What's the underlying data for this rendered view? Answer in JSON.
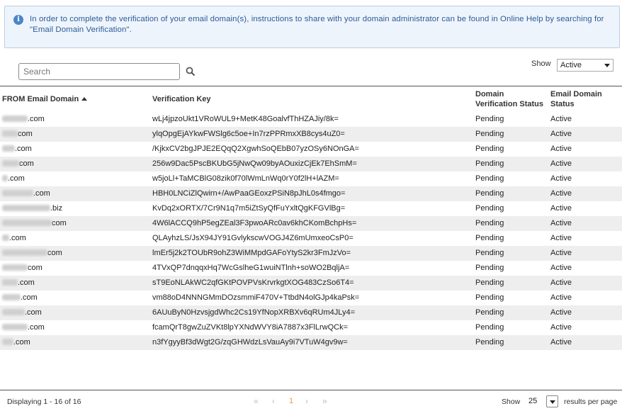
{
  "banner": {
    "icon": "info-icon",
    "text": "In order to complete the verification of your email domain(s), instructions to share with your domain administrator can be found in Online Help by searching for \"Email Domain Verification\"."
  },
  "search": {
    "placeholder": "Search",
    "value": "",
    "icon": "search-icon"
  },
  "filter": {
    "label": "Show",
    "selected": "Active"
  },
  "table": {
    "headers": {
      "domain": "FROM Email Domain",
      "key": "Verification Key",
      "dvs_line1": "Domain",
      "dvs_line2": "Verification Status",
      "eds_line1": "Email Domain",
      "eds_line2": "Status"
    },
    "sort": {
      "column": "FROM Email Domain",
      "direction": "ascending"
    },
    "rows": [
      {
        "domain": ".com",
        "key": "wLj4jpzoUkt1VRoWUL9+MetK48GoalvfThHZAJiy/8k=",
        "dvs": "Pending",
        "eds": "Active"
      },
      {
        "domain": "com",
        "key": "ylqOpgEjAYkwFWSlg6c5oe+In7rzPPRmxXB8cys4uZ0=",
        "dvs": "Pending",
        "eds": "Active"
      },
      {
        "domain": ".com",
        "key": "/KjkxCV2bgJPJE2EQqQ2XgwhSoQEbB07yzOSy6NOnGA=",
        "dvs": "Pending",
        "eds": "Active"
      },
      {
        "domain": "com",
        "key": "256w9Dac5PscBKUbG5jNwQw09byAOuxizCjEk7EhSmM=",
        "dvs": "Pending",
        "eds": "Active"
      },
      {
        "domain": ".com",
        "key": "w5joLl+TaMCBlG08zik0f70lWmLnWq0rY0f2lH+lAZM=",
        "dvs": "Pending",
        "eds": "Active"
      },
      {
        "domain": ".com",
        "key": "HBH0LNCiZlQwirn+/AwPaaGEoxzPSiN8pJhL0s4fmgo=",
        "dvs": "Pending",
        "eds": "Active"
      },
      {
        "domain": ".biz",
        "key": "KvDq2xORTX/7Cr9N1q7m5iZtSyQfFuYxltQgKFGVlBg=",
        "dvs": "Pending",
        "eds": "Active"
      },
      {
        "domain": "com",
        "key": "4W6lACCQ9hP5egZEal3F3pwoARc0av6khCKomBchpHs=",
        "dvs": "Pending",
        "eds": "Active"
      },
      {
        "domain": ".com",
        "key": "QLAyhzLS/JsX94JY91GvlykscwVOGJ4Z6mUmxeoCsP0=",
        "dvs": "Pending",
        "eds": "Active"
      },
      {
        "domain": "com",
        "key": "lmEr5j2k2TOUbR9ohZ3WiMMpdGAFoYtyS2kr3FmJzVo=",
        "dvs": "Pending",
        "eds": "Active"
      },
      {
        "domain": "com",
        "key": "4TVxQP7dnqqxHq7WcGslheG1wuiNTlnh+soWO2BqljA=",
        "dvs": "Pending",
        "eds": "Active"
      },
      {
        "domain": ".com",
        "key": "sT9EoNLAkWC2qfGKtPOVPVsKrvrkgtXOG483CzSo6T4=",
        "dvs": "Pending",
        "eds": "Active"
      },
      {
        "domain": ".com",
        "key": "vm88oD4NNNGMmDOzsmmiF470V+TtbdN4olGJp4kaPsk=",
        "dvs": "Pending",
        "eds": "Active"
      },
      {
        "domain": ".com",
        "key": "6AUuByN0HzvsjgdWhc2Cs19YfNopXRBXv6qRUm4JLy4=",
        "dvs": "Pending",
        "eds": "Active"
      },
      {
        "domain": ".com",
        "key": "fcamQrT8gwZuZVKt8lpYXNdWVY8iA7887x3FlLrwQCk=",
        "dvs": "Pending",
        "eds": "Active"
      },
      {
        "domain": ".com",
        "key": "n3fYgyyBf3dWgt2G/zqGHWdzLsVauAy9i7VTuW4gv9w=",
        "dvs": "Pending",
        "eds": "Active"
      }
    ]
  },
  "footer": {
    "displaying": "Displaying 1 - 16 of 16",
    "pager": {
      "first": "«",
      "prev": "‹",
      "current": "1",
      "next": "›",
      "last": "»"
    },
    "show_label": "Show",
    "per_page": "25",
    "per_page_suffix": "results per page"
  }
}
